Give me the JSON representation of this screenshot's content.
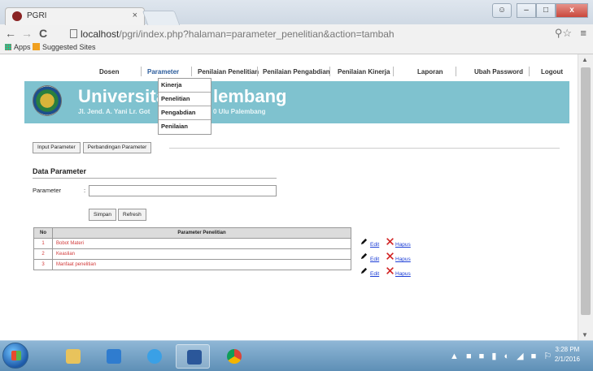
{
  "browser": {
    "tab_title": "PGRI",
    "tab_close": "×",
    "address_host": "localhost",
    "address_path": "/pgri/index.php?halaman=parameter_penelitian&action=tambah",
    "bookmarks": [
      "Apps",
      "Suggested Sites"
    ],
    "window_buttons": [
      "–",
      "□",
      "x"
    ]
  },
  "site": {
    "nav": [
      "Dosen",
      "Parameter",
      "Penilaian Penelitian",
      "Penilaian Pengabdian",
      "Penilaian Kinerja",
      "Laporan",
      "Ubah Password",
      "Logout"
    ],
    "dropdown": [
      "Kinerja",
      "Penelitian",
      "Pengabdian",
      "Penilaian"
    ],
    "banner_title_left": "Universitas",
    "banner_title_right": "lembang",
    "banner_sub_left": "Jl. Jend. A. Yani Lr. Got",
    "banner_sub_right": "0 Ulu Palembang"
  },
  "form": {
    "subtabs": [
      "Input Parameter",
      "Perbandingan Parameter"
    ],
    "section_title": "Data Parameter",
    "parameter_label": "Parameter",
    "colon": ":",
    "parameter_value": "",
    "save_button": "Simpan",
    "refresh_button": "Refresh"
  },
  "table": {
    "headers": [
      "No",
      "Parameter Penelitian"
    ],
    "rows": [
      {
        "no": "1",
        "name": "Bobot Materi"
      },
      {
        "no": "2",
        "name": "Keaslian"
      },
      {
        "no": "3",
        "name": "Manfaat penelitian"
      }
    ],
    "edit_label": "Edit",
    "delete_label": "Hapus"
  },
  "taskbar": {
    "time": "3:28 PM",
    "date": "2/1/2016"
  }
}
